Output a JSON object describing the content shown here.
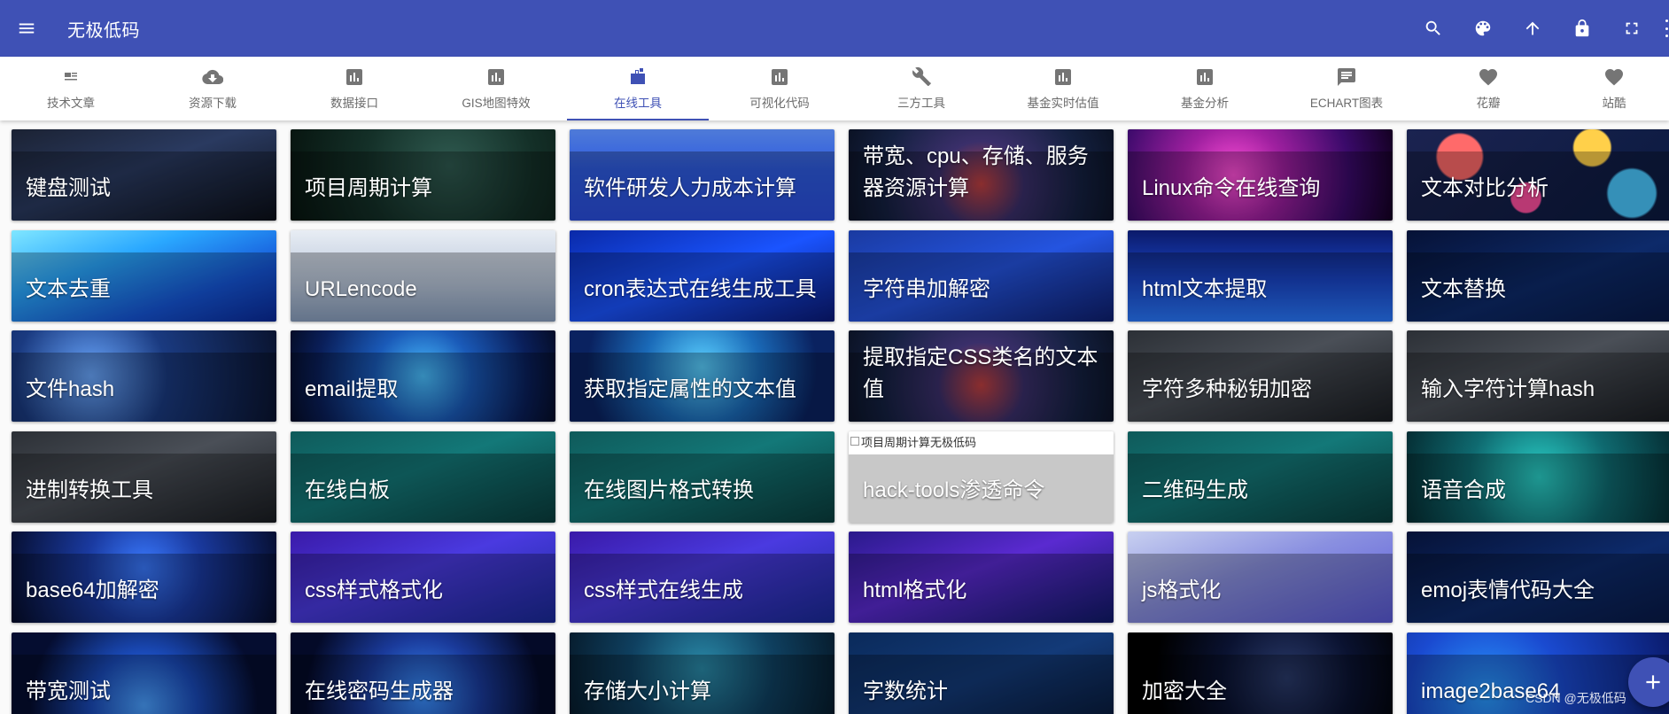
{
  "app": {
    "title": "无极低码",
    "actions": [
      "search-icon",
      "palette-icon",
      "arrow-up-icon",
      "lock-icon",
      "fullscreen-icon"
    ]
  },
  "tabs": [
    {
      "label": "技术文章",
      "icon": "article-icon"
    },
    {
      "label": "资源下载",
      "icon": "cloud-download-icon"
    },
    {
      "label": "数据接口",
      "icon": "bar-chart-icon"
    },
    {
      "label": "GIS地图特效",
      "icon": "bar-chart-icon"
    },
    {
      "label": "在线工具",
      "icon": "toolbox-icon",
      "active": true
    },
    {
      "label": "可视化代码",
      "icon": "bar-chart-icon"
    },
    {
      "label": "三方工具",
      "icon": "wrench-icon"
    },
    {
      "label": "基金实时估值",
      "icon": "bar-chart-icon"
    },
    {
      "label": "基金分析",
      "icon": "bar-chart-icon"
    },
    {
      "label": "ECHART图表",
      "icon": "comment-icon"
    },
    {
      "label": "花瓣",
      "icon": "heart-icon"
    },
    {
      "label": "站酷",
      "icon": "heart-icon"
    }
  ],
  "cards": [
    {
      "label": "键盘测试",
      "theme": "keyboard"
    },
    {
      "label": "项目周期计算",
      "theme": "circuit"
    },
    {
      "label": "软件研发人力成本计算",
      "theme": "calc"
    },
    {
      "label": "带宽、cpu、存储、服务器资源计算",
      "theme": "circuitred"
    },
    {
      "label": "Linux命令在线查询",
      "theme": "linux"
    },
    {
      "label": "文本对比分析",
      "theme": "bokeh"
    },
    {
      "label": "文本去重",
      "theme": "wave"
    },
    {
      "label": "URLencode",
      "theme": "http"
    },
    {
      "label": "cron表达式在线生成工具",
      "theme": "bluecode"
    },
    {
      "label": "字符串加解密",
      "theme": "isoblue"
    },
    {
      "label": "html文本提取",
      "theme": "city"
    },
    {
      "label": "文本替换",
      "theme": "darkblue"
    },
    {
      "label": "文件hash",
      "theme": "at"
    },
    {
      "label": "email提取",
      "theme": "globe"
    },
    {
      "label": "获取指定属性的文本值",
      "theme": "globe2"
    },
    {
      "label": "提取指定CSS类名的文本值",
      "theme": "circuitred"
    },
    {
      "label": "字符多种秘钥加密",
      "theme": "darkgray"
    },
    {
      "label": "输入字符计算hash",
      "theme": "darkgray"
    },
    {
      "label": "进制转换工具",
      "theme": "darkgray"
    },
    {
      "label": "在线白板",
      "theme": "qr"
    },
    {
      "label": "在线图片格式转换",
      "theme": "qr"
    },
    {
      "label": "hack-tools渗透命令",
      "theme": "broken",
      "alt": "项目周期计算无极低码"
    },
    {
      "label": "二维码生成",
      "theme": "qr"
    },
    {
      "label": "语音合成",
      "theme": "tealhex"
    },
    {
      "label": "base64加解密",
      "theme": "lock"
    },
    {
      "label": "css样式格式化",
      "theme": "iso"
    },
    {
      "label": "css样式在线生成",
      "theme": "iso"
    },
    {
      "label": "html格式化",
      "theme": "iso2"
    },
    {
      "label": "js格式化",
      "theme": "isolight"
    },
    {
      "label": "emoj表情代码大全",
      "theme": "darkblue"
    },
    {
      "label": "带宽测试",
      "theme": "earth"
    },
    {
      "label": "在线密码生成器",
      "theme": "earth2"
    },
    {
      "label": "存储大小计算",
      "theme": "tealnet"
    },
    {
      "label": "字数统计",
      "theme": "navy"
    },
    {
      "label": "加密大全",
      "theme": "blackglobe"
    },
    {
      "label": "image2base64",
      "theme": "hexblue"
    }
  ],
  "watermark": "CSDN @无极低码"
}
